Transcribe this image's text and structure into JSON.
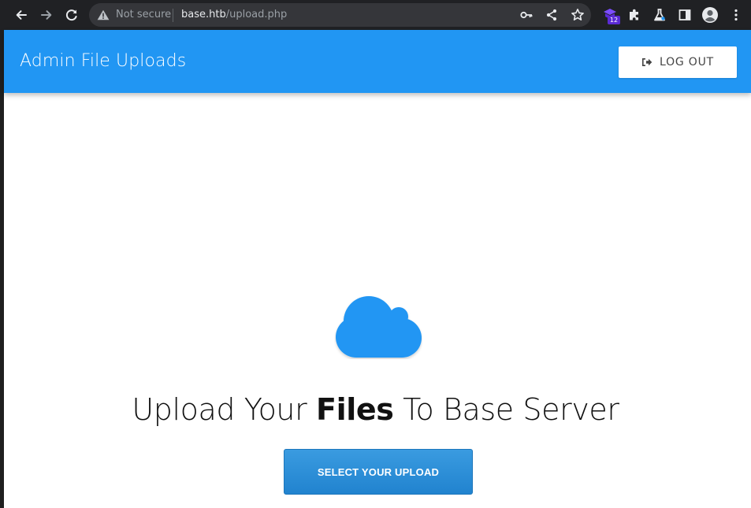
{
  "browser": {
    "security_label": "Not secure",
    "url_host": "base.htb",
    "url_path": "/upload.php",
    "extension_badge": "12",
    "icons": [
      "back-icon",
      "forward-icon",
      "reload-icon",
      "warning-icon",
      "key-icon",
      "share-icon",
      "star-icon",
      "extension-icon",
      "puzzle-icon",
      "flask-icon",
      "side-panel-icon",
      "profile-icon",
      "menu-icon"
    ]
  },
  "header": {
    "title": "Admin File Uploads",
    "logout_label": "LOG OUT",
    "bg_color": "#2196f3"
  },
  "main": {
    "headline_before": "Upload Your ",
    "headline_bold": "Files",
    "headline_after": " To Base Server",
    "upload_button_label": "SELECT YOUR UPLOAD",
    "cloud_color": "#2196f3"
  }
}
